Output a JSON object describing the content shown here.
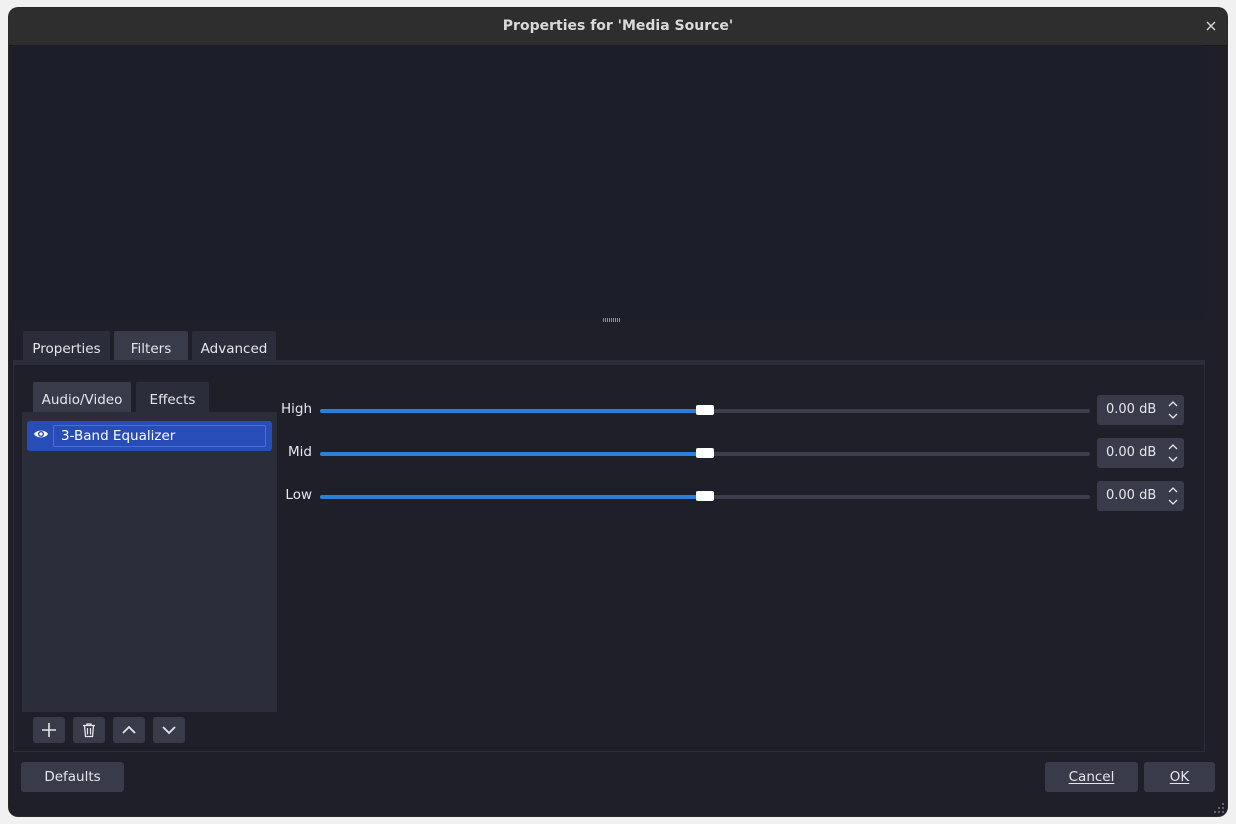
{
  "window": {
    "title": "Properties for 'Media Source'"
  },
  "tabs": [
    {
      "label": "Properties"
    },
    {
      "label": "Filters",
      "active": true
    },
    {
      "label": "Advanced"
    }
  ],
  "filters": {
    "subtabs": [
      {
        "label": "Audio/Video",
        "active": true
      },
      {
        "label": "Effects"
      }
    ],
    "items": [
      {
        "label": "3-Band Equalizer",
        "visible": true,
        "selected": true
      }
    ]
  },
  "equalizer": {
    "rows": [
      {
        "label": "High",
        "value": "0.00 dB",
        "level": 0.5
      },
      {
        "label": "Mid",
        "value": "0.00 dB",
        "level": 0.5
      },
      {
        "label": "Low",
        "value": "0.00 dB",
        "level": 0.5
      }
    ]
  },
  "buttons": {
    "defaults": "Defaults",
    "cancel": "Cancel",
    "ok": "OK"
  },
  "icons": {
    "close": "close-icon",
    "eye": "eye-icon",
    "add": "plus-icon",
    "remove": "trash-icon",
    "up": "chevron-up-icon",
    "down": "chevron-down-icon"
  },
  "colors": {
    "accent": "#2b7fd8",
    "selection": "#284cb8"
  }
}
